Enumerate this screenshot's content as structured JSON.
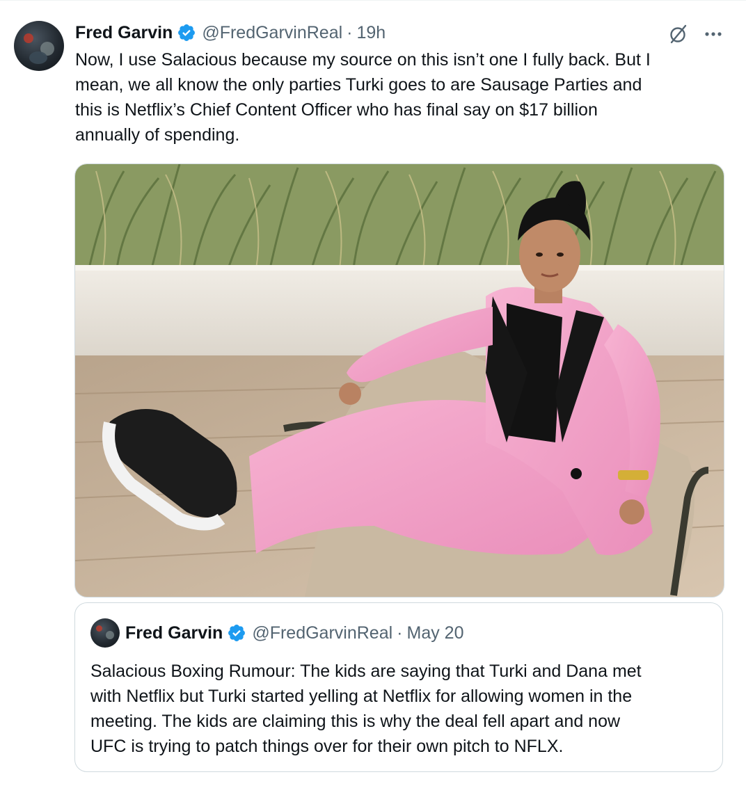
{
  "tweet": {
    "author_name": "Fred Garvin",
    "handle": "@FredGarvinReal",
    "separator": "·",
    "time": "19h",
    "text_lines": [
      "Now, I use Salacious because my source on this isn’t one I fully back. But I",
      "mean, we all know the only parties Turki goes to are Sausage Parties and",
      "this is Netflix’s Chief Content Officer who has final say on $17 billion",
      "annually of spending."
    ],
    "actions": {
      "grok_icon": "grok-slash-icon",
      "more_icon": "more-horizontal-icon"
    }
  },
  "media": {
    "description_icon": "photo-image"
  },
  "quoted_tweet": {
    "author_name": "Fred Garvin",
    "handle": "@FredGarvinReal",
    "separator": "·",
    "time": "May 20",
    "text_lines": [
      "Salacious Boxing Rumour: The kids are saying that Turki and Dana met",
      "with Netflix but Turki started yelling at Netflix for allowing women in the",
      "meeting. The kids are claiming this is why the deal fell apart and now",
      "UFC is trying to patch things over for their own pitch to NFLX."
    ]
  },
  "colors": {
    "verified": "#1d9bf0",
    "secondary_text": "#536471",
    "primary_text": "#0f1419",
    "border": "#cfd9de"
  }
}
